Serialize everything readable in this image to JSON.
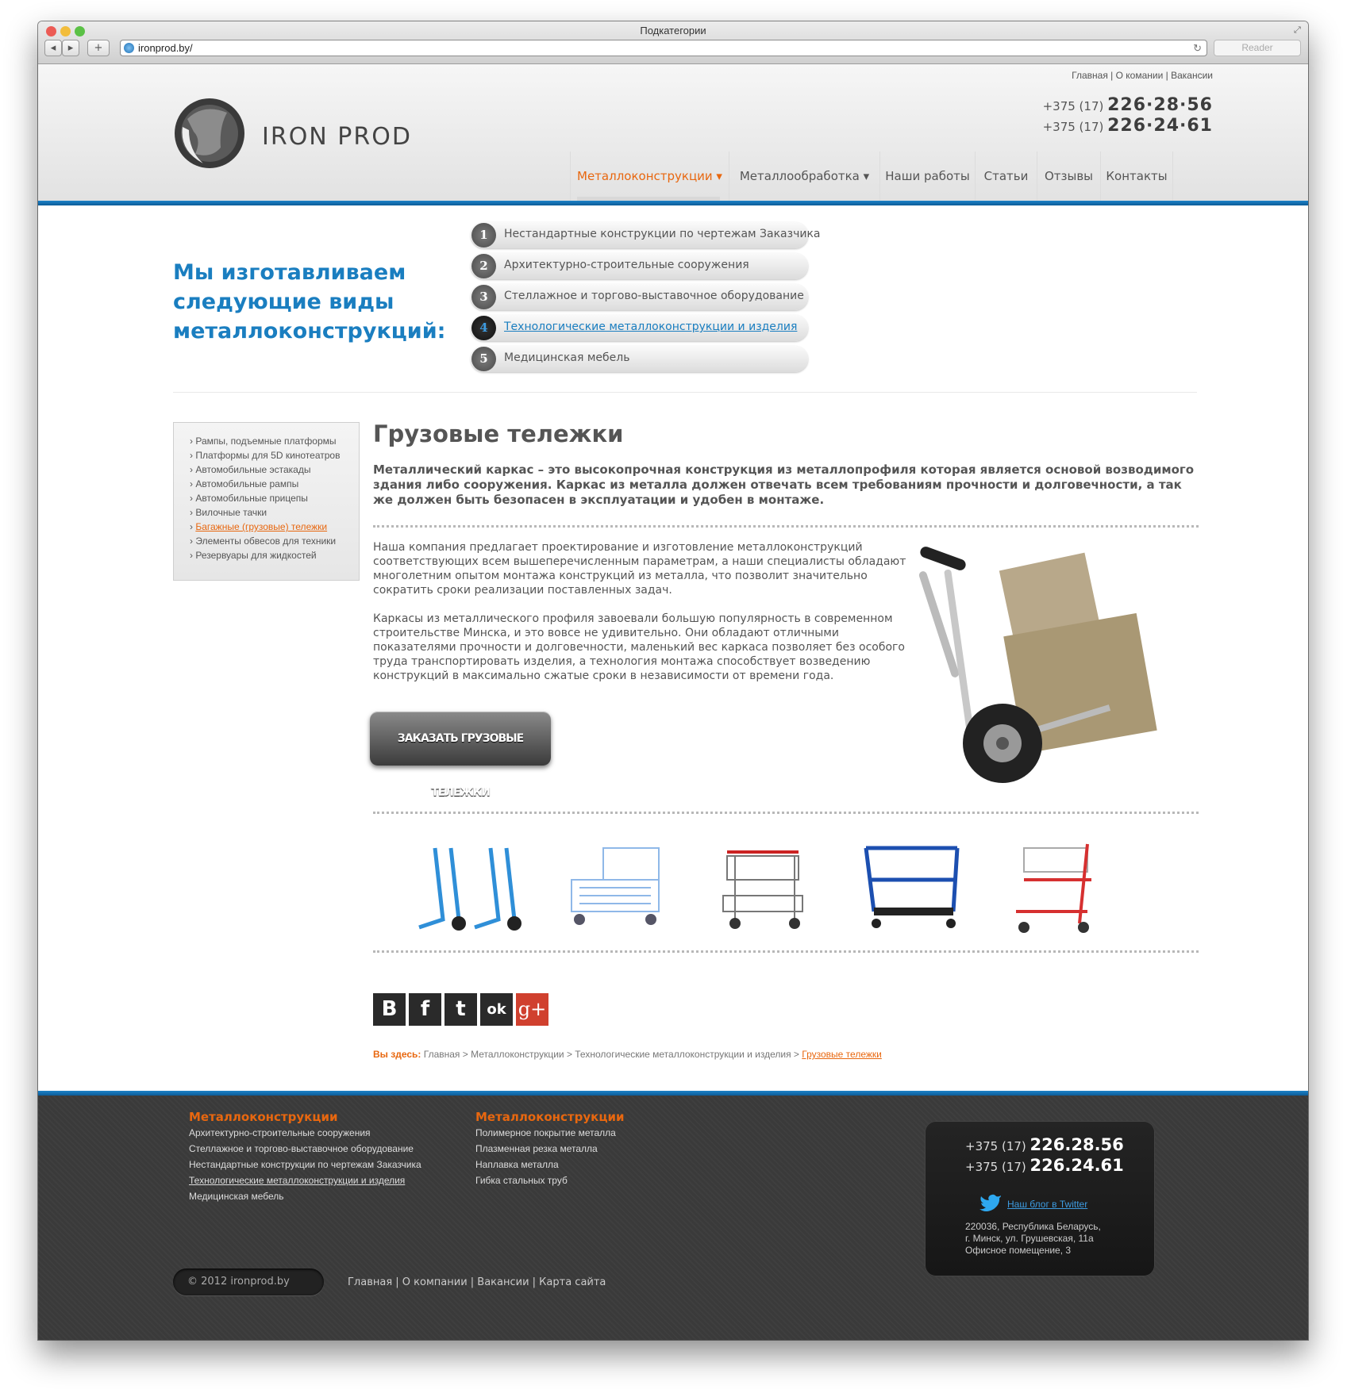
{
  "browser": {
    "title": "Подкатегории",
    "url": "ironprod.by/",
    "reader_label": "Reader",
    "new_tab": "+"
  },
  "header": {
    "top_links": "Главная | О комании | Вакансии",
    "phones": [
      {
        "code": "+375 (17)",
        "number": "226·28·56"
      },
      {
        "code": "+375 (17)",
        "number": "226·24·61"
      }
    ],
    "logo_text": "IRON PROD",
    "menu": [
      {
        "label": "Металлоконструкции ▾"
      },
      {
        "label": "Металлообработка ▾"
      },
      {
        "label": "Наши работы"
      },
      {
        "label": "Статьи"
      },
      {
        "label": "Отзывы"
      },
      {
        "label": "Контакты"
      }
    ]
  },
  "hero": {
    "title": "Мы изготавливаем следующие виды металлоконструкций:",
    "items": [
      {
        "num": "1",
        "label": "Нестандартные конструкции по чертежам Заказчика"
      },
      {
        "num": "2",
        "label": "Архитектурно-строительные сооружения"
      },
      {
        "num": "3",
        "label": "Стеллажное и торгово-выставочное оборудование"
      },
      {
        "num": "4",
        "label": "Технологические металлоконструкции и изделия"
      },
      {
        "num": "5",
        "label": "Медицинская мебель"
      }
    ]
  },
  "sidebar": {
    "items": [
      "Рампы, подъемные платформы",
      "Платформы для 5D кинотеатров",
      "Автомобильные эстакады",
      "Автомобильные рампы",
      "Автомобильные прицепы",
      "Вилочные тачки",
      "Багажные (грузовые) тележки",
      "Элементы обвесов для техники",
      "Резервуары для  жидкостей"
    ]
  },
  "content": {
    "title": "Грузовые тележки",
    "lead": "Металлический каркас – это высокопрочная конструкция из металлопрофиля которая является основой возводимого здания либо сооружения. Каркас из металла должен отвечать всем требованиям прочности и долговечности, а так же должен быть безопасен в эксплуатации и удобен в монтаже.",
    "p1": "Наша компания предлагает проектирование и изготовление металлоконструкций соответствующих всем вышеперечисленным параметрам, а наши специалисты обладают многолетним опытом монтажа конструкций из металла, что позволит значительно сократить сроки реализации поставленных задач.",
    "p2": "Каркасы из металлического профиля завоевали большую популярность в современном строительстве Минска, и это вовсе не удивительно. Они обладают отличными показателями прочности и долговечности, маленький вес каркаса позволяет без особого труда транспортировать изделия, а технология монтажа способствует возведению конструкций в максимально сжатые сроки в независимости от времени года.",
    "order_button": "ЗАКАЗАТЬ ГРУЗОВЫЕ ТЕЛЕЖКИ",
    "social": [
      "В",
      "f",
      "t",
      "ok",
      "g+"
    ]
  },
  "breadcrumb": {
    "here": "Вы здесь:",
    "path": "Главная  >  Металлоконструкции   >  Технологические металлоконструкции и изделия  > ",
    "current": "Грузовые тележки"
  },
  "footer": {
    "col1_title": "Металлоконструкции",
    "col1": [
      "Архитектурно-строительные сооружения",
      "Стеллажное и торгово-выставочное оборудование",
      "Нестандартные конструкции по чертежам Заказчика",
      "Технологические металлоконструкции и изделия",
      "Медицинская мебель"
    ],
    "col2_title": "Металлоконструкции",
    "col2": [
      "Полимерное покрытие металла",
      "Плазменная резка металла",
      "Наплавка металла",
      "Гибка стальных труб"
    ],
    "copyright": "© 2012 ironprod.by",
    "links": "Главная  |  О компании  |  Вакансии  |  Карта сайта",
    "phones": [
      {
        "code": "+375 (17)",
        "number": "226.28.56"
      },
      {
        "code": "+375 (17)",
        "number": "226.24.61"
      }
    ],
    "twitter": "Наш блог в Twitter",
    "address": [
      "220036, Республика Беларусь,",
      "г. Минск, ул. Грушевская, 11а",
      "Офисное помещение, 3"
    ]
  },
  "colors": {
    "accent_orange": "#e8670f",
    "brand_blue": "#1a7ec0",
    "footer_bg": "#3a3a3a"
  }
}
